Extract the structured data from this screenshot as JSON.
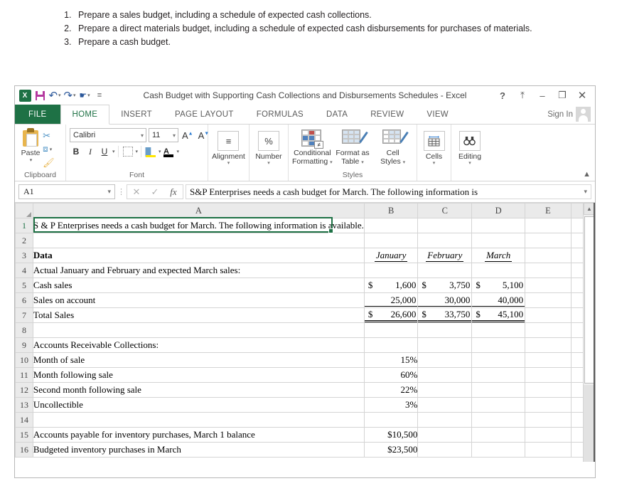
{
  "instructions": [
    "Prepare a sales budget, including a schedule of expected cash collections.",
    "Prepare a direct materials budget, including a schedule of expected cash disbursements for purchases of materials.",
    "Prepare a cash budget."
  ],
  "window": {
    "title": "Cash Budget with Supporting Cash Collections and Disbursements Schedules - Excel",
    "help_glyph": "?",
    "ribbon_display_glyph": "⤒",
    "minimize_glyph": "–",
    "restore_glyph": "❐",
    "close_glyph": "✕",
    "sign_in": "Sign In"
  },
  "quick_access": {
    "app_logo": "X",
    "items": [
      "save-icon",
      "undo-icon",
      "redo-icon",
      "touch-mode-icon",
      "customize-qat-icon"
    ]
  },
  "tabs": [
    {
      "label": "FILE",
      "active": false,
      "file": true
    },
    {
      "label": "HOME",
      "active": true
    },
    {
      "label": "INSERT",
      "active": false
    },
    {
      "label": "PAGE LAYOUT",
      "active": false
    },
    {
      "label": "FORMULAS",
      "active": false
    },
    {
      "label": "DATA",
      "active": false
    },
    {
      "label": "REVIEW",
      "active": false
    },
    {
      "label": "VIEW",
      "active": false
    }
  ],
  "ribbon": {
    "clipboard": {
      "group_label": "Clipboard",
      "paste_label": "Paste",
      "cut_label": "✂",
      "copy_label": "⧉",
      "format_painter_label": "🖌"
    },
    "font": {
      "group_label": "Font",
      "font_name": "Calibri",
      "font_size": "11",
      "grow_font": "A",
      "shrink_font": "A",
      "bold": "B",
      "italic": "I",
      "underline": "U",
      "font_color": "A"
    },
    "alignment": {
      "group_label": "Alignment",
      "icon": "≡"
    },
    "number": {
      "group_label": "Number",
      "icon": "%"
    },
    "styles": {
      "group_label": "Styles",
      "conditional_formatting": "Conditional\nFormatting",
      "conditional_formatting_l1": "Conditional",
      "conditional_formatting_l2": "Formatting",
      "format_as_table_l1": "Format as",
      "format_as_table_l2": "Table",
      "cell_styles_l1": "Cell",
      "cell_styles_l2": "Styles",
      "cf_badge": "≠"
    },
    "cells": {
      "group_label": "Cells"
    },
    "editing": {
      "group_label": "Editing",
      "icon": "♟"
    }
  },
  "formula_bar": {
    "name_box": "A1",
    "cancel_glyph": "✕",
    "enter_glyph": "✓",
    "function_glyph": "fx",
    "content": "S&P Enterprises needs a cash budget for March. The following information is"
  },
  "sheet": {
    "columns": [
      "A",
      "B",
      "C",
      "D",
      "E",
      ""
    ],
    "active_cell": "A1",
    "rows": [
      {
        "num": "1",
        "a": "S & P Enterprises needs a cash budget for March. The following information is available.",
        "b": "",
        "c": "",
        "d": "",
        "e": ""
      },
      {
        "num": "2",
        "a": "",
        "b": "",
        "c": "",
        "d": "",
        "e": ""
      },
      {
        "num": "3",
        "a": "Data",
        "b": "January",
        "c": "February",
        "d": "March",
        "e": "",
        "style": "header"
      },
      {
        "num": "4",
        "a": "Actual January and February and expected March sales:",
        "b": "",
        "c": "",
        "d": "",
        "e": ""
      },
      {
        "num": "5",
        "a": "Cash sales",
        "b": "1,600",
        "c": "3,750",
        "d": "5,100",
        "e": "",
        "style": "money"
      },
      {
        "num": "6",
        "a": "Sales on account",
        "b": "25,000",
        "c": "30,000",
        "d": "40,000",
        "e": "",
        "style": "money-underline"
      },
      {
        "num": "7",
        "a": "Total Sales",
        "b": "26,600",
        "c": "33,750",
        "d": "45,100",
        "e": "",
        "style": "money-total"
      },
      {
        "num": "8",
        "a": "",
        "b": "",
        "c": "",
        "d": "",
        "e": ""
      },
      {
        "num": "9",
        "a": "Accounts Receivable Collections:",
        "b": "",
        "c": "",
        "d": "",
        "e": ""
      },
      {
        "num": "10",
        "a": "Month of sale",
        "b": "15%",
        "c": "",
        "d": "",
        "e": "",
        "style": "indent-pct"
      },
      {
        "num": "11",
        "a": "Month following sale",
        "b": "60%",
        "c": "",
        "d": "",
        "e": "",
        "style": "indent-pct"
      },
      {
        "num": "12",
        "a": "Second month following sale",
        "b": "22%",
        "c": "",
        "d": "",
        "e": "",
        "style": "indent-pct"
      },
      {
        "num": "13",
        "a": "Uncollectible",
        "b": "3%",
        "c": "",
        "d": "",
        "e": "",
        "style": "indent-pct"
      },
      {
        "num": "14",
        "a": "",
        "b": "",
        "c": "",
        "d": "",
        "e": ""
      },
      {
        "num": "15",
        "a": "Accounts payable for inventory purchases, March 1 balance",
        "b": "$10,500",
        "c": "",
        "d": "",
        "e": "",
        "style": "plain-right"
      },
      {
        "num": "16",
        "a": "Budgeted inventory purchases in March",
        "b": "$23,500",
        "c": "",
        "d": "",
        "e": "",
        "style": "plain-right"
      }
    ]
  },
  "colors": {
    "excel_green": "#1e7145",
    "grid_line": "#d4d4d4",
    "header_fill": "#eaeaea",
    "active_border": "#1e7145"
  }
}
